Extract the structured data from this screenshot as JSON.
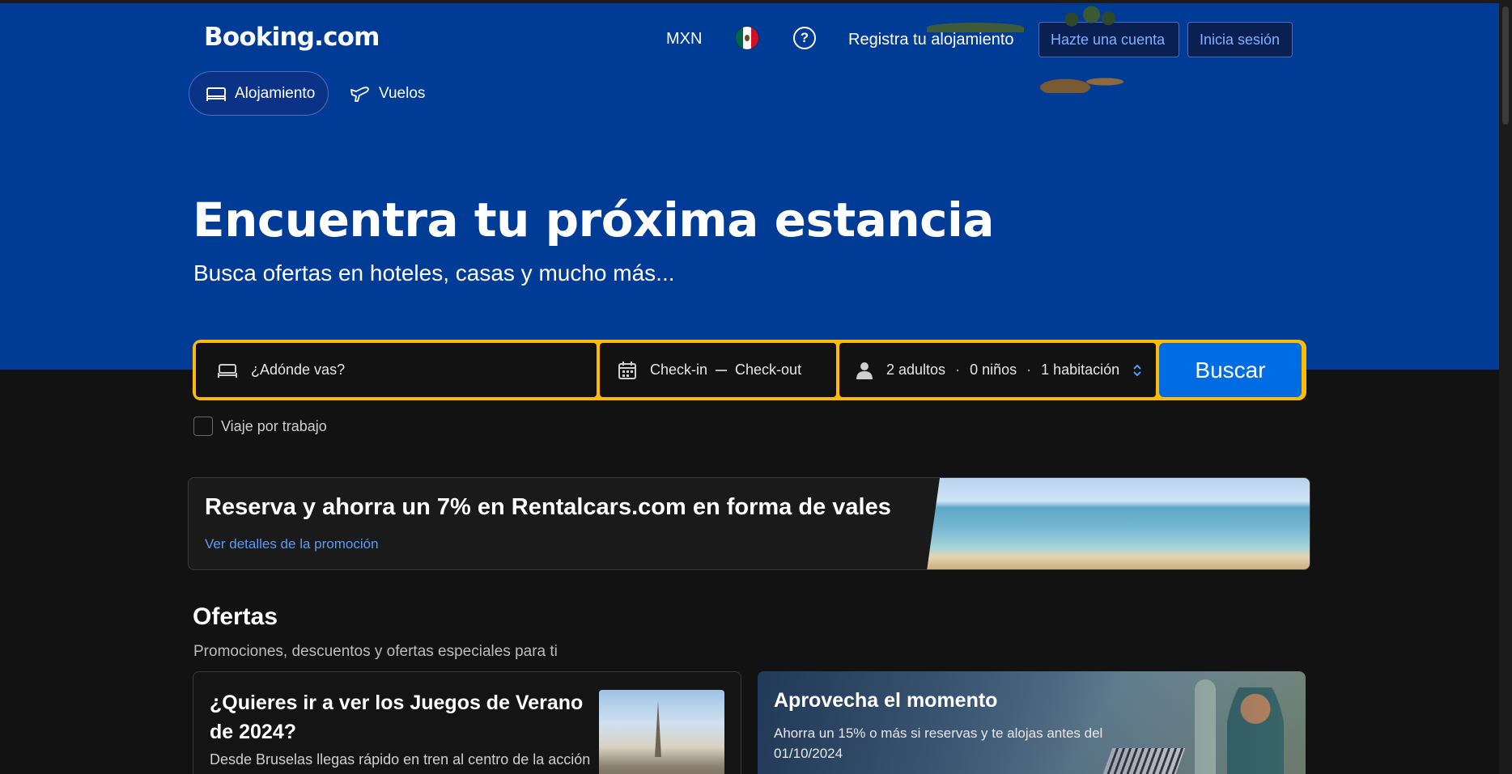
{
  "header": {
    "logo": "Booking.com",
    "currency": "MXN",
    "register_property": "Registra tu alojamiento",
    "create_account": "Hazte una cuenta",
    "sign_in": "Inicia sesión"
  },
  "tabs": [
    {
      "label": "Alojamiento",
      "icon": "bed-icon",
      "selected": true
    },
    {
      "label": "Vuelos",
      "icon": "plane-icon",
      "selected": false
    }
  ],
  "hero": {
    "title": "Encuentra tu próxima estancia",
    "subtitle": "Busca ofertas en hoteles, casas y mucho más..."
  },
  "search": {
    "destination_placeholder": "¿Adónde vas?",
    "check_in": "Check-in",
    "check_out": "Check-out",
    "adults": "2 adultos",
    "children": "0 niños",
    "rooms": "1 habitación",
    "separator": "·",
    "button": "Buscar",
    "work_trip": "Viaje por trabajo"
  },
  "promo": {
    "title": "Reserva y ahorra un 7% en Rentalcars.com en forma de vales",
    "link": "Ver detalles de la promoción"
  },
  "offers": {
    "title": "Ofertas",
    "subtitle": "Promociones, descuentos y ofertas especiales para ti",
    "cards": [
      {
        "title": "¿Quieres ir a ver los Juegos de Verano de 2024?",
        "text": "Desde Bruselas llegas rápido en tren al centro de la acción"
      },
      {
        "title": "Aprovecha el momento",
        "text": "Ahorra un 15% o más si reservas y te alojas antes del 01/10/2024"
      }
    ]
  },
  "colors": {
    "brand_blue": "#003b95",
    "search_yellow": "#febb02",
    "button_blue": "#006ce4",
    "link_blue": "#5d9bf0",
    "background": "#121212"
  }
}
